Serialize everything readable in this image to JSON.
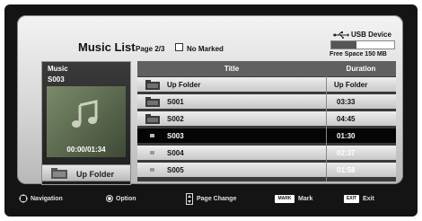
{
  "header": {
    "title": "Music List",
    "page_info": "Page 2/3",
    "marked": "No Marked",
    "usb_label": "USB Device",
    "free_space": "Free Space 150 MB",
    "free_used_fraction": 0.4
  },
  "preview": {
    "heading": "Music",
    "file": "S003",
    "time": "00:00/01:34",
    "up_folder_label": "Up Folder"
  },
  "list": {
    "col_title": "Title",
    "col_duration": "Duration",
    "rows": [
      {
        "name": "Up Folder",
        "duration": "Up Folder",
        "type": "folder"
      },
      {
        "name": "S001",
        "duration": "03:33",
        "type": "folder"
      },
      {
        "name": "S002",
        "duration": "04:45",
        "type": "folder"
      },
      {
        "name": "S003",
        "duration": "01:30",
        "type": "file",
        "selected": true
      },
      {
        "name": "S004",
        "duration": "02:37",
        "type": "file"
      },
      {
        "name": "S005",
        "duration": "01:58",
        "type": "file"
      }
    ]
  },
  "footer": {
    "navigation": "Navigation",
    "option": "Option",
    "page_change": "Page Change",
    "mark_key": "MARK",
    "mark": "Mark",
    "exit_key": "EXIT",
    "exit": "Exit"
  },
  "icons": [
    "usb-icon",
    "folder-icon",
    "music-note-icon",
    "check-box-icon",
    "navigation-icon",
    "option-icon",
    "page-change-icon"
  ]
}
